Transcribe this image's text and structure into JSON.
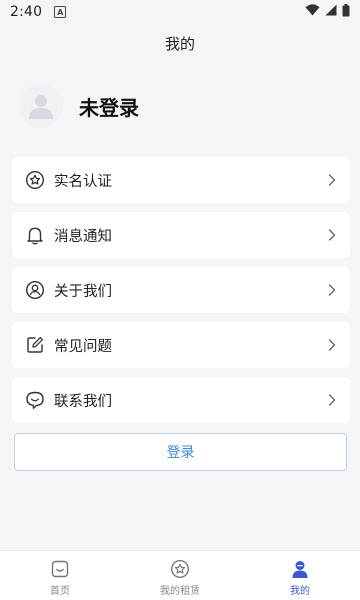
{
  "status_bar": {
    "time": "2:40",
    "notification_icon": "A"
  },
  "header": {
    "title": "我的"
  },
  "profile": {
    "name": "未登录",
    "avatar_icon": "user-avatar-icon"
  },
  "menu": [
    {
      "label": "实名认证",
      "icon": "certificate-star-icon"
    },
    {
      "label": "消息通知",
      "icon": "bell-icon"
    },
    {
      "label": "关于我们",
      "icon": "person-circle-icon"
    },
    {
      "label": "常见问题",
      "icon": "edit-icon"
    },
    {
      "label": "联系我们",
      "icon": "chat-bubble-icon"
    }
  ],
  "login_button": {
    "label": "登录"
  },
  "tabbar": {
    "tabs": [
      {
        "label": "首页",
        "icon": "home-icon",
        "active": false
      },
      {
        "label": "我的租赁",
        "icon": "star-icon",
        "active": false
      },
      {
        "label": "我的",
        "icon": "user-icon",
        "active": true
      }
    ]
  },
  "colors": {
    "accent": "#3a56d4",
    "login_text": "#3a86d6",
    "background": "#f5f5f7"
  }
}
